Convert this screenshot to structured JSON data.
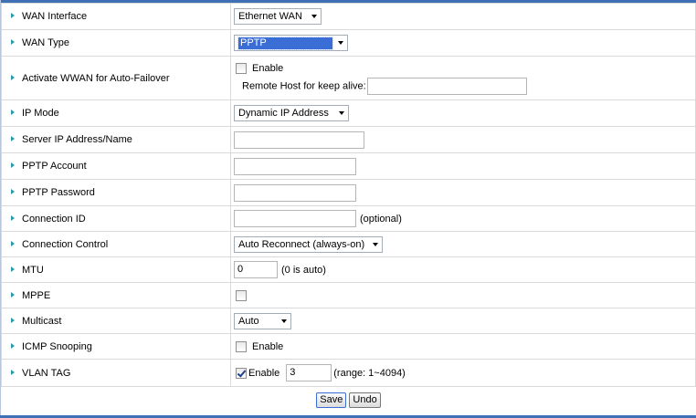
{
  "rows": {
    "wan_interface": {
      "label": "WAN Interface",
      "value": "Ethernet WAN"
    },
    "wan_type": {
      "label": "WAN Type",
      "value": "PPTP"
    },
    "failover": {
      "label": "Activate WWAN for Auto-Failover",
      "enable_label": "Enable",
      "enabled": false,
      "remote_host_label": "Remote Host for keep alive:",
      "remote_host_value": ""
    },
    "ip_mode": {
      "label": "IP Mode",
      "value": "Dynamic IP Address"
    },
    "server_ip": {
      "label": "Server IP Address/Name",
      "value": ""
    },
    "pptp_account": {
      "label": "PPTP Account",
      "value": ""
    },
    "pptp_password": {
      "label": "PPTP Password",
      "value": ""
    },
    "connection_id": {
      "label": "Connection ID",
      "value": "",
      "hint": "(optional)"
    },
    "connection_control": {
      "label": "Connection Control",
      "value": "Auto Reconnect (always-on)"
    },
    "mtu": {
      "label": "MTU",
      "value": "0",
      "hint": "(0 is auto)"
    },
    "mppe": {
      "label": "MPPE",
      "enabled": false
    },
    "multicast": {
      "label": "Multicast",
      "value": "Auto"
    },
    "icmp_snooping": {
      "label": "ICMP Snooping",
      "enable_label": "Enable",
      "enabled": false
    },
    "vlan_tag": {
      "label": "VLAN TAG",
      "enable_label": "Enable",
      "enabled": true,
      "value": "3",
      "hint": "(range: 1~4094)"
    }
  },
  "buttons": {
    "save": "Save",
    "undo": "Undo"
  },
  "colors": {
    "accent": "#3f6fb5",
    "arrow": "#2d9aa8",
    "selection": "#3a6ed6"
  }
}
